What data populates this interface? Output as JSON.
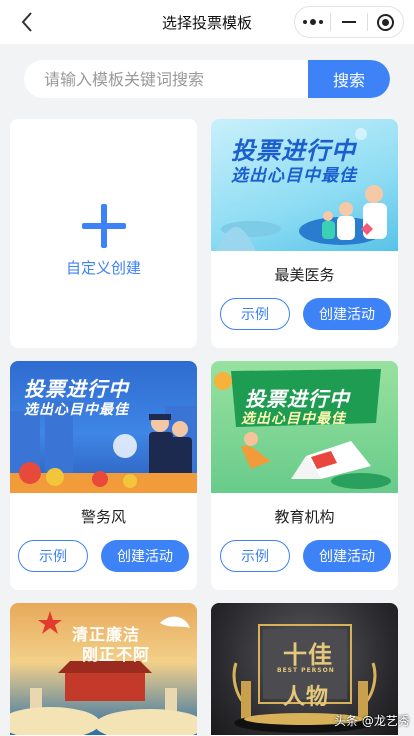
{
  "nav": {
    "title": "选择投票模板"
  },
  "search": {
    "placeholder": "请输入模板关键词搜索",
    "button_label": "搜索"
  },
  "custom_card": {
    "label": "自定义创建"
  },
  "banner": {
    "line1": "投票进行中",
    "line2": "选出心目中最佳"
  },
  "templates": [
    {
      "name": "最美医务",
      "example_label": "示例",
      "create_label": "创建活动"
    },
    {
      "name": "警务风",
      "example_label": "示例",
      "create_label": "创建活动"
    },
    {
      "name": "教育机构",
      "example_label": "示例",
      "create_label": "创建活动"
    }
  ],
  "bottom_cards": [
    {
      "art_line1": "清正廉洁",
      "art_line2": "刚正不阿"
    },
    {
      "art_line1": "十佳",
      "art_subtitle": "BEST PERSON",
      "art_line2": "人物"
    }
  ],
  "watermark": "头条 @龙艺秀",
  "colors": {
    "accent": "#3d82f6",
    "background": "#f2f3f5"
  }
}
